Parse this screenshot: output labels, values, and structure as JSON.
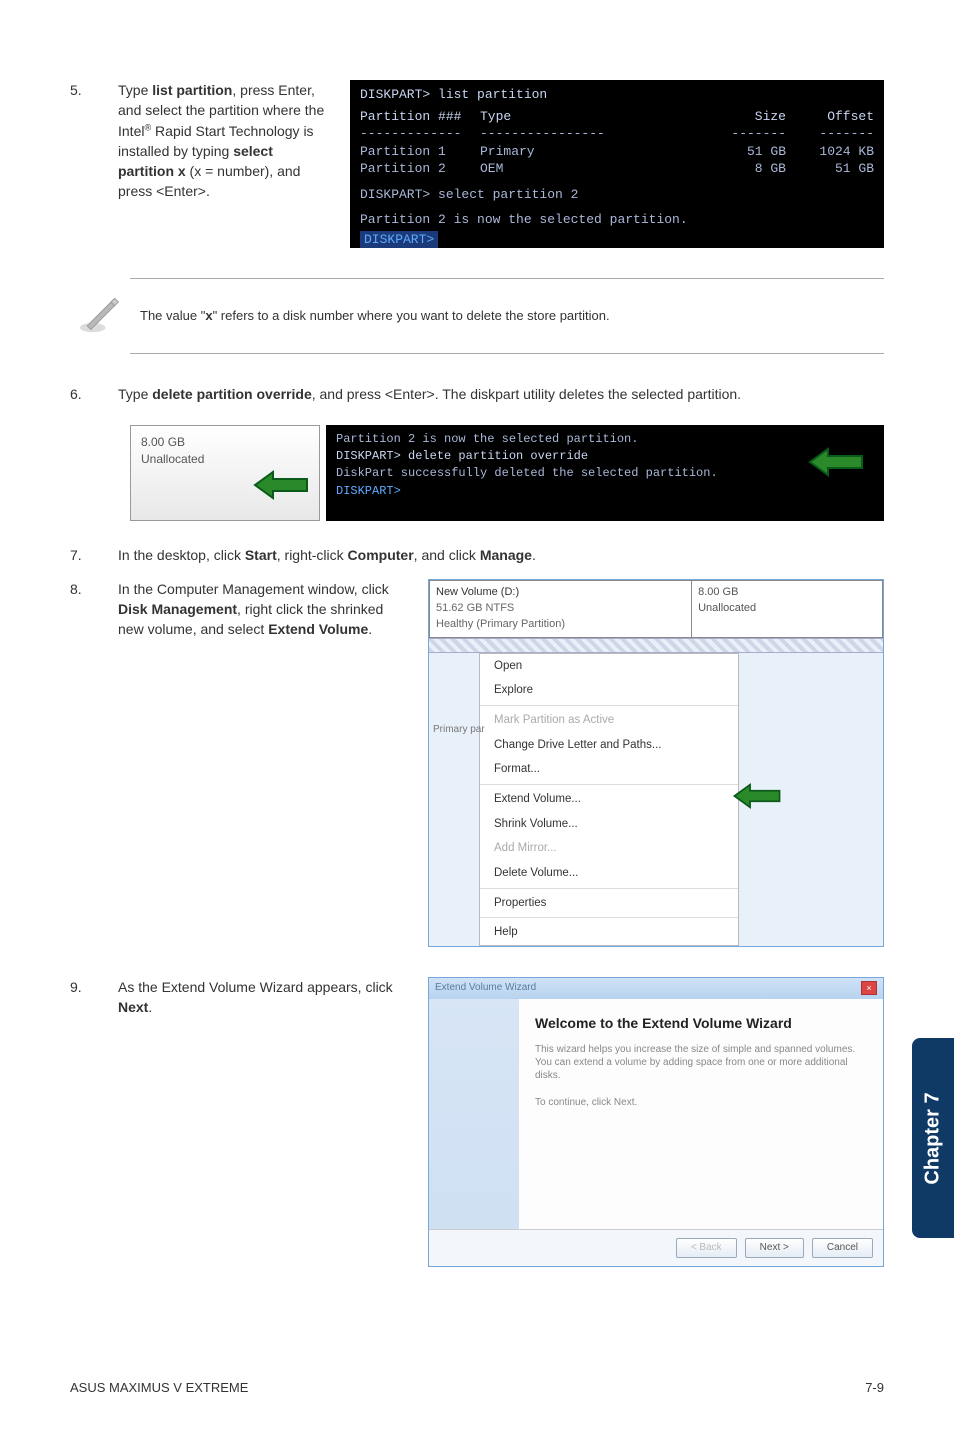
{
  "steps": {
    "s5": {
      "num": "5.",
      "before_bold1": "Type ",
      "bold1": "list partition",
      "after_bold1": ", press Enter, and select the partition where the Intel",
      "sup": "®",
      "after_sup": " Rapid Start Technology is installed by typing ",
      "bold2": "select partition x",
      "after_bold2": " (x = number),  and press <Enter>."
    },
    "s6": {
      "num": "6.",
      "before_bold": "Type ",
      "bold": "delete partition override",
      "after_bold": ", and press <Enter>. The diskpart utility deletes the selected partition."
    },
    "s7": {
      "num": "7.",
      "t1": "In the desktop, click ",
      "b1": "Start",
      "t2": ", right-click ",
      "b2": "Computer",
      "t3": ", and click ",
      "b3": "Manage",
      "t4": "."
    },
    "s8": {
      "num": "8.",
      "t1": "In the Computer Management window, click ",
      "b1": "Disk Management",
      "t2": ", right click the shrinked new volume, and select ",
      "b2": "Extend Volume",
      "t3": "."
    },
    "s9": {
      "num": "9.",
      "t1": "As the Extend Volume Wizard appears, click ",
      "b1": "Next",
      "t2": "."
    }
  },
  "note": {
    "pre": "The value \"",
    "bold": "x",
    "post": "\" refers to a disk number where you want to delete the store partition."
  },
  "console1": {
    "prompt": "DISKPART> list partition",
    "hdr": {
      "c1": "Partition ###",
      "c2": "Type",
      "c3": "Size",
      "c4": "Offset"
    },
    "r1": {
      "c1": "Partition 1",
      "c2": "Primary",
      "c3": "51 GB",
      "c4": "1024 KB"
    },
    "r2": {
      "c1": "Partition 2",
      "c2": "OEM",
      "c3": "8 GB",
      "c4": "51 GB"
    },
    "l3": "DISKPART> select partition 2",
    "l4": "Partition 2 is now the selected partition.",
    "l5": "DISKPART>"
  },
  "diskbox": {
    "size": "8.00 GB",
    "status": "Unallocated"
  },
  "console2": {
    "l1": "Partition 2 is now the selected partition.",
    "l2": "DISKPART> delete partition override",
    "l3": "DiskPart successfully deleted the selected partition.",
    "l4": "DISKPART>"
  },
  "dm": {
    "vol_title": "New Volume (D:)",
    "vol_size": "51.62 GB NTFS",
    "vol_health": "Healthy (Primary Partition)",
    "un_size": "8.00 GB",
    "un_status": "Unallocated",
    "primary_lbl": "Primary par",
    "menu": {
      "open": "Open",
      "explore": "Explore",
      "mark": "Mark Partition as Active",
      "change": "Change Drive Letter and Paths...",
      "format": "Format...",
      "extend": "Extend Volume...",
      "shrink": "Shrink Volume...",
      "addmirror": "Add Mirror...",
      "delete": "Delete Volume...",
      "props": "Properties",
      "help": "Help"
    }
  },
  "wizard": {
    "title": "Extend Volume Wizard",
    "heading": "Welcome to the Extend Volume Wizard",
    "p1": "This wizard helps you increase the size of simple and spanned volumes. You can extend a volume by adding space from one or more additional disks.",
    "p2": "To continue, click Next.",
    "btn_back": "< Back",
    "btn_next": "Next >",
    "btn_cancel": "Cancel"
  },
  "chapter": "Chapter 7",
  "footer": {
    "left": "ASUS MAXIMUS V EXTREME",
    "right": "7-9"
  }
}
